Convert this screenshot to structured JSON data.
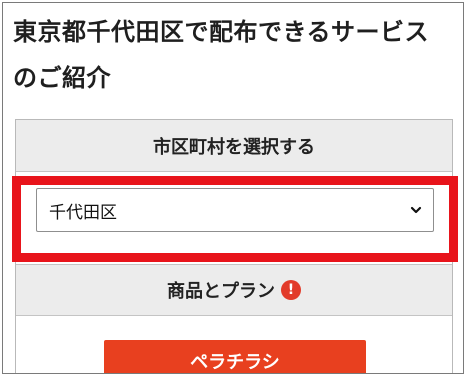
{
  "page": {
    "heading": "東京都千代田区で配布できるサービスのご紹介"
  },
  "area_panel": {
    "header": "市区町村を選択する",
    "select_value": "千代田区"
  },
  "product_panel": {
    "header": "商品とプラン",
    "warning_glyph": "!",
    "button_label": "ペラチラシ"
  },
  "colors": {
    "highlight": "#e8141b",
    "button": "#e8401f",
    "warning": "#e23b2a"
  }
}
